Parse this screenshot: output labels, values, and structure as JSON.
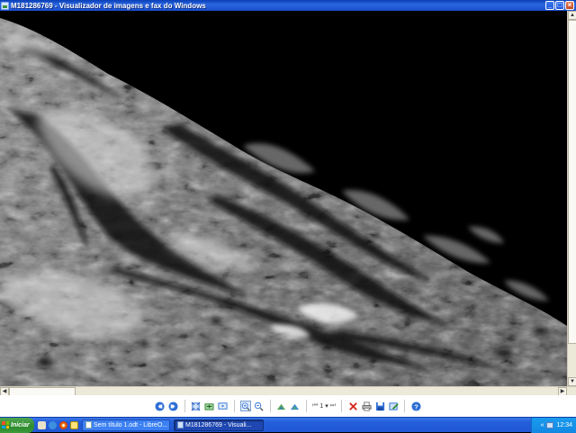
{
  "window": {
    "title": "M181286769 - Visualizador de imagens e fax do Windows",
    "controls": [
      "minimize",
      "maximize",
      "close"
    ]
  },
  "image": {
    "description_icon": "lunar-surface-image"
  },
  "toolbar": {
    "buttons": [
      {
        "name": "previous-image-button",
        "icon": "previous-icon"
      },
      {
        "name": "next-image-button",
        "icon": "next-icon"
      },
      {
        "name": "best-fit-button",
        "icon": "best-fit-icon"
      },
      {
        "name": "actual-size-button",
        "icon": "actual-size-icon"
      },
      {
        "name": "slideshow-button",
        "icon": "slideshow-icon"
      },
      {
        "name": "zoom-in-button",
        "icon": "zoom-in-icon"
      },
      {
        "name": "zoom-out-button",
        "icon": "zoom-out-icon"
      },
      {
        "name": "rotate-clockwise-button",
        "icon": "rotate-clockwise-icon"
      },
      {
        "name": "rotate-counterclockwise-button",
        "icon": "rotate-counterclockwise-icon"
      },
      {
        "name": "delete-button",
        "icon": "delete-icon"
      },
      {
        "name": "print-button",
        "icon": "print-icon"
      },
      {
        "name": "save-button",
        "icon": "save-icon"
      },
      {
        "name": "edit-button",
        "icon": "edit-icon"
      },
      {
        "name": "help-button",
        "icon": "help-icon"
      }
    ],
    "page_number": "1"
  },
  "taskbar": {
    "start_label": "Iniciar",
    "tasks": [
      {
        "label": "Sem título 1.odt - LibreO...",
        "active": false
      },
      {
        "label": "M181286769 - Visuali...",
        "active": true
      }
    ],
    "tray_expand": "«",
    "clock": "12:34"
  },
  "colors": {
    "titlebar": "#2a66e0",
    "taskbar": "#245edb",
    "start": "#2e8b2e",
    "tray": "#1288e3"
  }
}
